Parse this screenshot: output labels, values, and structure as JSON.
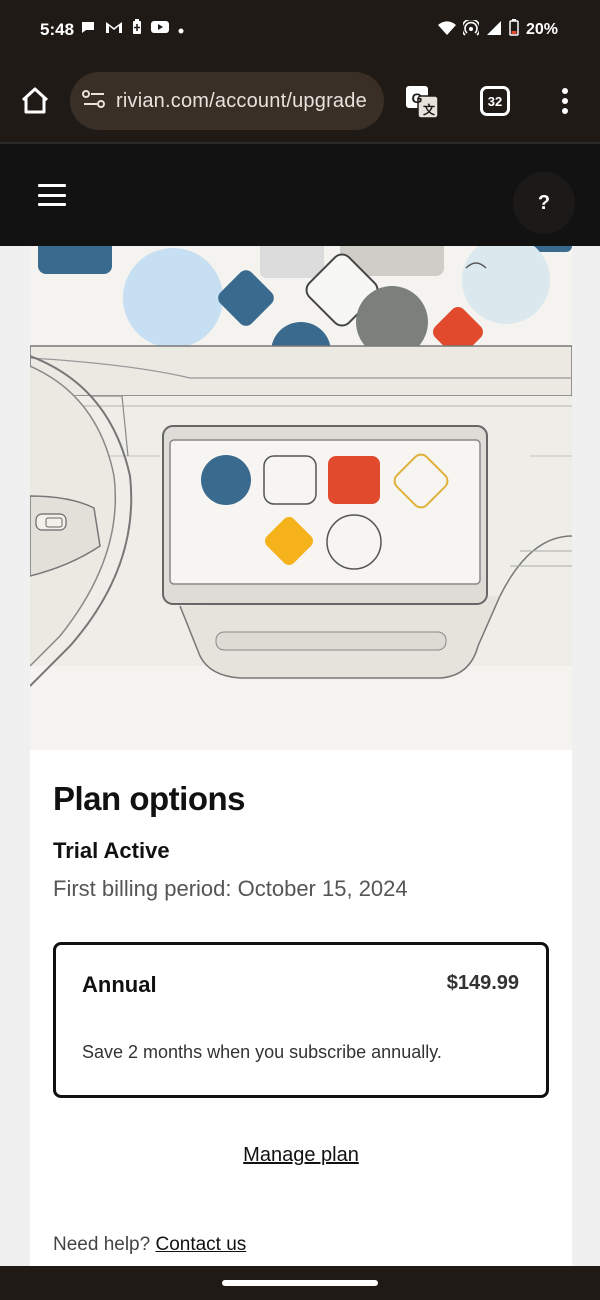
{
  "status_bar": {
    "time": "5:48",
    "battery": "20%",
    "left_icons": [
      "chat-icon",
      "gmail-icon",
      "battery-saver-icon",
      "youtube-icon",
      "dot-icon"
    ],
    "right_icons": [
      "wifi-icon",
      "hotspot-icon",
      "signal-icon",
      "battery-icon"
    ]
  },
  "browser": {
    "url": "rivian.com/account/upgrade",
    "tab_count": "32"
  },
  "site_header": {
    "help_label": "?"
  },
  "plan": {
    "title": "Plan options",
    "status": "Trial Active",
    "billing": "First billing period: October 15, 2024",
    "card": {
      "name": "Annual",
      "price": "$149.99",
      "description": "Save 2 months when you subscribe annually."
    },
    "manage_label": "Manage plan",
    "help_prefix": "Need help?",
    "contact_label": "Contact us"
  },
  "colors": {
    "system_bar": "#1f1a15",
    "site_header": "#121212",
    "accent_blue": "#3a6b8f",
    "accent_red": "#e24a2e",
    "accent_yellow": "#f5b21b"
  }
}
